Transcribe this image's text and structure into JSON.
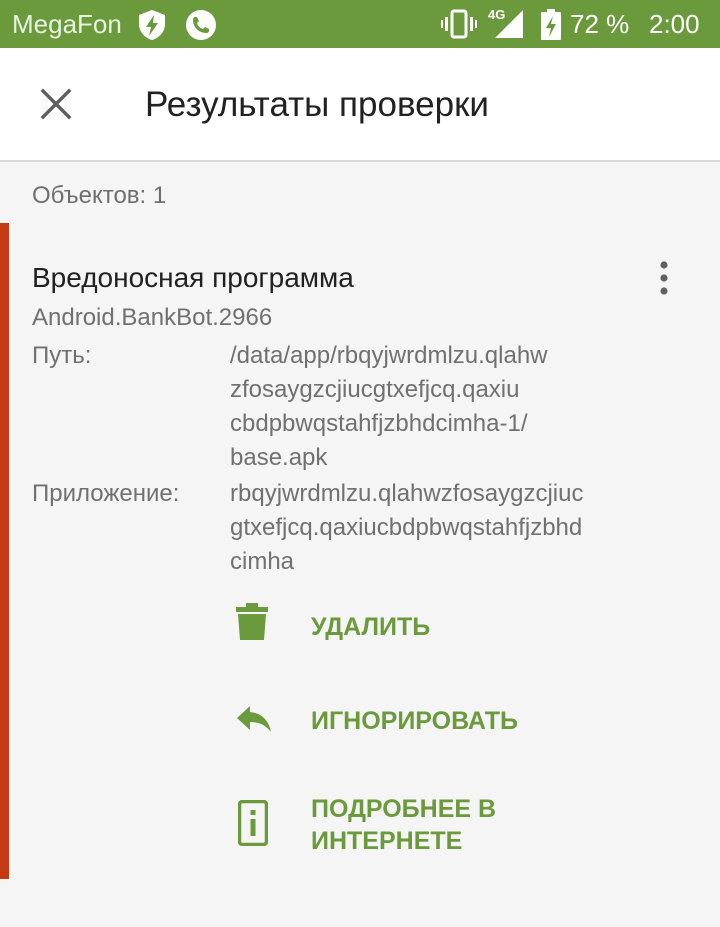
{
  "status_bar": {
    "carrier": "MegaFon",
    "network": "4G",
    "battery_percent": "72 %",
    "time": "2:00"
  },
  "app_bar": {
    "title": "Результаты проверки",
    "close_icon": "close-icon"
  },
  "results": {
    "count_label": "Объектов: 1"
  },
  "threat": {
    "title": "Вредоносная программа",
    "name": "Android.BankBot.2966",
    "path_label": "Путь:",
    "path_lines": [
      "/data/app/rbqyjwrdmlzu.qlahw",
      "zfosaygzcjiucgtxefjcq.qaxiu",
      "cbdpbwqstahfjzbhdcimha-1/",
      "base.apk"
    ],
    "app_label": "Приложение:",
    "app_lines": [
      "rbqyjwrdmlzu.qlahwzfosaygzcjiuc",
      "gtxefjcq.qaxiucbdpbwqstahfjzbhd",
      "cimha"
    ]
  },
  "actions": {
    "delete_label": "УДАЛИТЬ",
    "ignore_label": "ИГНОРИРОВАТЬ",
    "more_info_line1": "ПОДРОБНЕЕ В",
    "more_info_line2": "ИНТЕРНЕТЕ"
  },
  "colors": {
    "status_bar": "#6b9a3c",
    "accent": "#6b9a3c",
    "threat_stripe": "#c63a12",
    "background": "#f5f5f5"
  }
}
